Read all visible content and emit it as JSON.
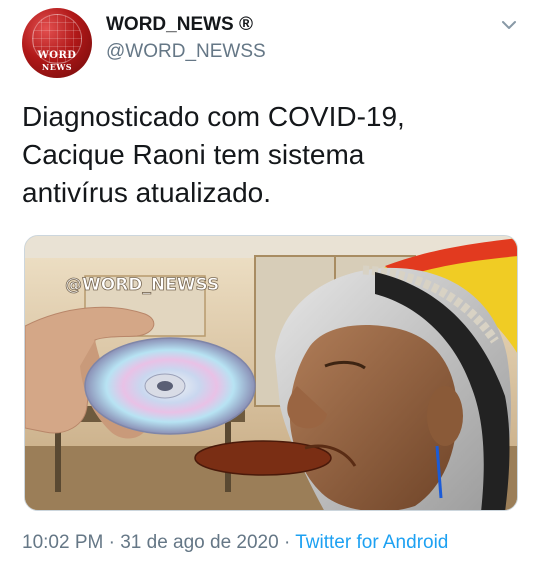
{
  "tweet": {
    "display_name": "WORD_NEWS ®",
    "handle": "@WORD_NEWSS",
    "avatar_text_line1": "WORD",
    "avatar_text_line2": "NEWS",
    "text_lines": [
      "Diagnosticado com COVID-19,",
      "Cacique Raoni tem sistema",
      "antivírus atualizado."
    ],
    "media_watermark": "@WORD_NEWSS",
    "timestamp": "10:02 PM · 31 de ago de 2020",
    "separator": " · ",
    "source": "Twitter for Android",
    "menu_icon": "chevron-down-icon"
  },
  "colors": {
    "text_primary": "#14171a",
    "text_secondary": "#657786",
    "link": "#1da1f2",
    "avatar_red": "#b01818"
  }
}
